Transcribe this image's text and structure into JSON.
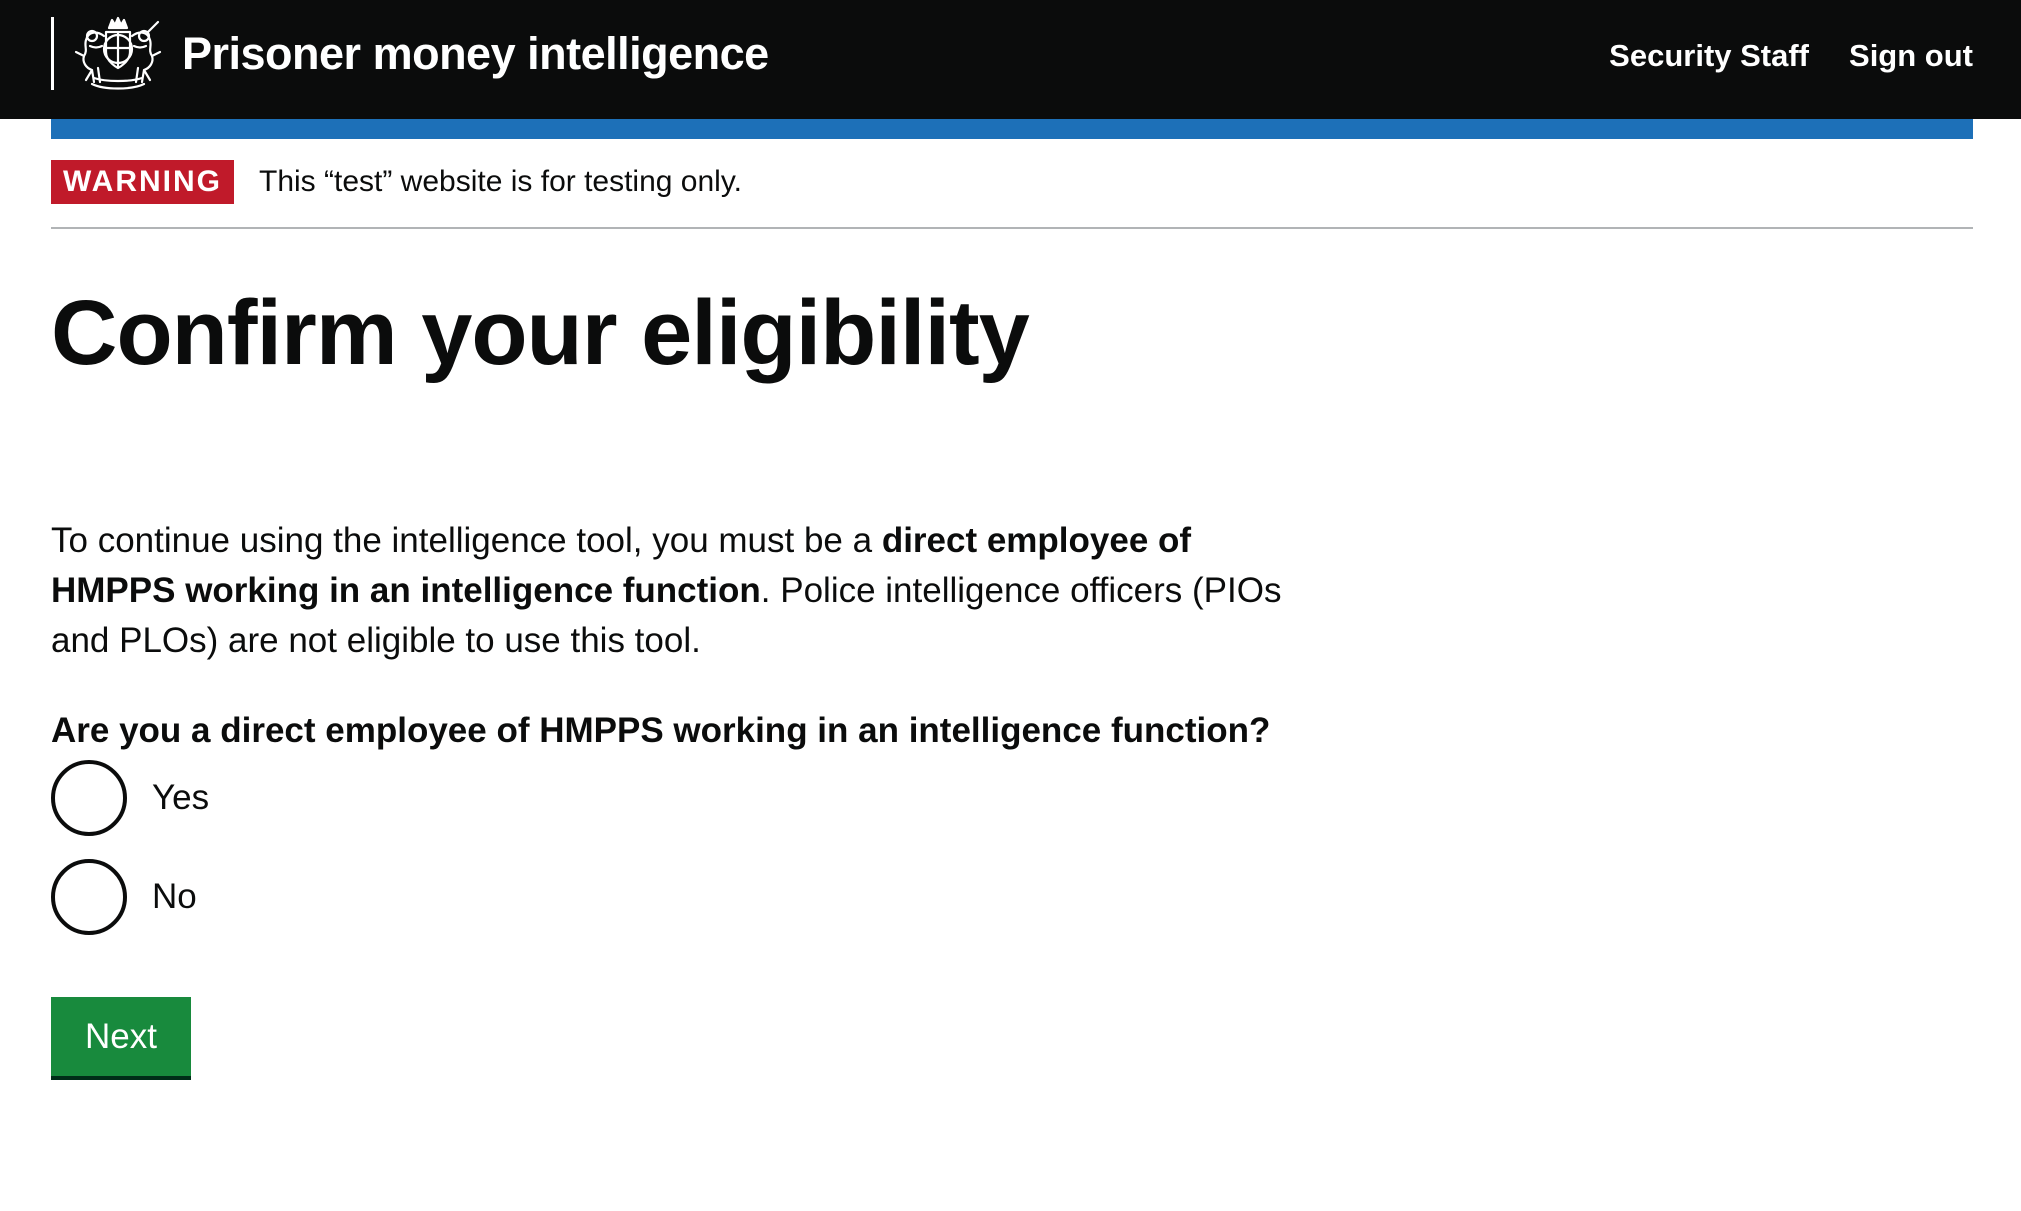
{
  "header": {
    "service_name": "Prisoner money intelligence",
    "crest_icon": "royal-coat-of-arms-icon",
    "nav": {
      "security_staff": "Security Staff",
      "sign_out": "Sign out"
    }
  },
  "banner": {
    "tag": "WARNING",
    "text": "This “test” website is for testing only."
  },
  "main": {
    "title": "Confirm your eligibility",
    "intro": {
      "part1": "To continue using the intelligence tool, you must be a ",
      "bold": "direct employee of HMPPS working in an intelligence function",
      "part2": ". Police intelligence officers (PIOs and PLOs) are not eligible to use this tool."
    },
    "question": "Are you a direct employee of HMPPS working in an intelligence function?",
    "options": [
      {
        "label": "Yes",
        "selected": false
      },
      {
        "label": "No",
        "selected": false
      }
    ],
    "next_label": "Next"
  },
  "colors": {
    "header_bg": "#0b0c0c",
    "blue_bar": "#1d70b8",
    "warning_tag": "#c01a2a",
    "button": "#188a3d"
  }
}
